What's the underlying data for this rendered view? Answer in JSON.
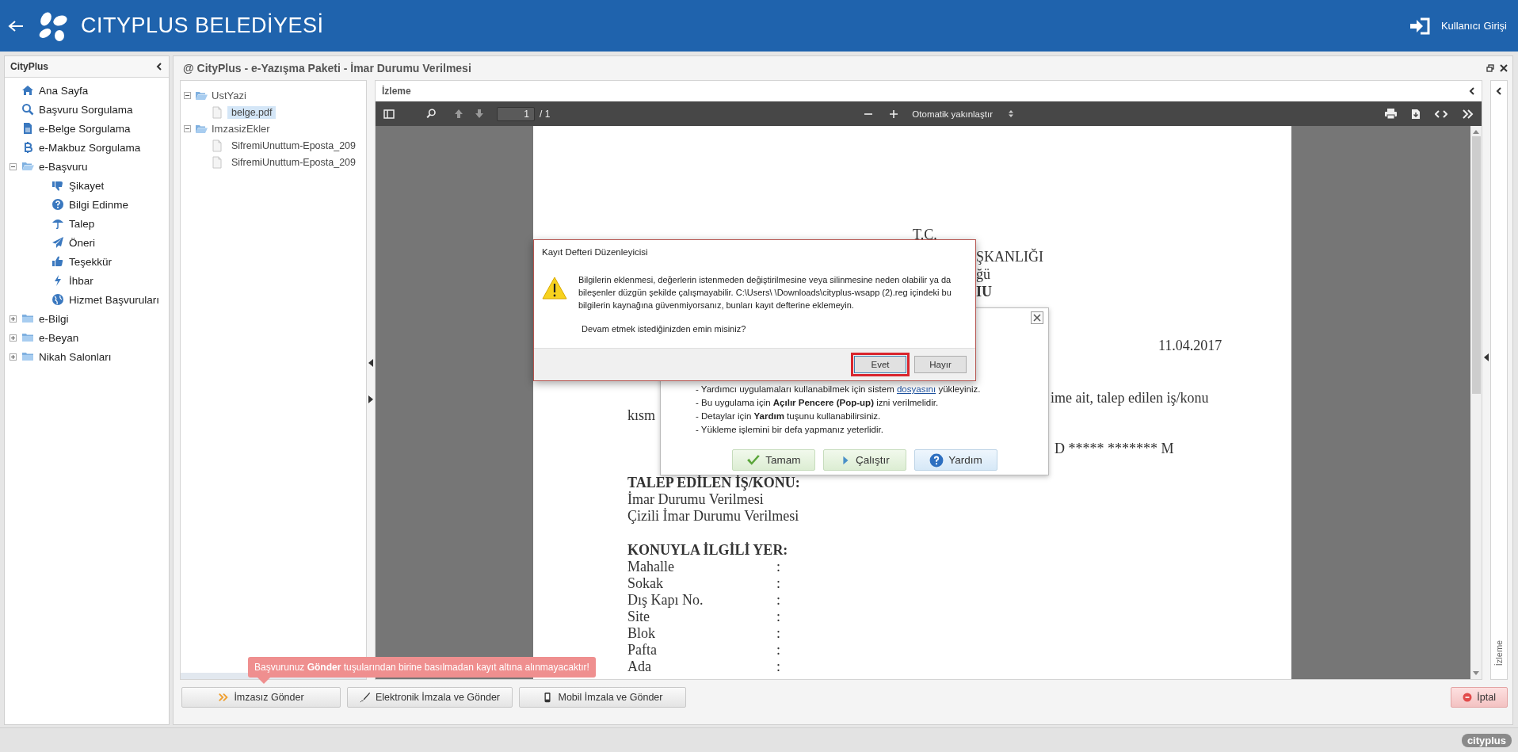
{
  "header": {
    "title": "CITYPLUS BELEDİYESİ",
    "login": "Kullanıcı Girişi"
  },
  "sidebar": {
    "title": "CityPlus",
    "items": [
      {
        "kind": "link",
        "label": "Ana Sayfa"
      },
      {
        "kind": "link",
        "label": "Başvuru Sorgulama"
      },
      {
        "kind": "link",
        "label": "e-Belge Sorgulama"
      },
      {
        "kind": "link",
        "label": "e-Makbuz Sorgulama"
      },
      {
        "kind": "folder",
        "label": "e-Başvuru",
        "expanded": true,
        "children": [
          {
            "kind": "link",
            "label": "Şikayet"
          },
          {
            "kind": "link",
            "label": "Bilgi Edinme"
          },
          {
            "kind": "link",
            "label": "Talep"
          },
          {
            "kind": "link",
            "label": "Öneri"
          },
          {
            "kind": "link",
            "label": "Teşekkür"
          },
          {
            "kind": "link",
            "label": "İhbar"
          },
          {
            "kind": "link",
            "label": "Hizmet Başvuruları"
          }
        ]
      },
      {
        "kind": "folder",
        "label": "e-Bilgi",
        "expanded": false
      },
      {
        "kind": "folder",
        "label": "e-Beyan",
        "expanded": false
      },
      {
        "kind": "folder",
        "label": "Nikah Salonları",
        "expanded": false
      }
    ]
  },
  "panel": {
    "title": "@ CityPlus - e-Yazışma Paketi - İmar Durumu Verilmesi",
    "files": [
      {
        "label": "UstYazi",
        "expanded": true,
        "children": [
          {
            "label": "belge.pdf",
            "selected": true
          }
        ]
      },
      {
        "label": "ImzasizEkler",
        "expanded": true,
        "children": [
          {
            "label": "SifremiUnuttum-Eposta_209",
            "selected": false
          },
          {
            "label": "SifremiUnuttum-Eposta_209",
            "selected": false
          }
        ]
      }
    ],
    "viewer": {
      "title": "İzleme",
      "page_number": "1",
      "page_count": "/ 1",
      "zoom": "Otomatik yakınlaştır",
      "document": {
        "fragments": [
          {
            "text": "T.C.",
            "bold": false
          },
          {
            "text": "ŞKANLIĞI",
            "bold": false
          },
          {
            "text": "ğü",
            "bold": false
          },
          {
            "text": "IU",
            "bold": true
          },
          {
            "text": "11.04.2017",
            "bold": false
          },
          {
            "text": "ime ait, talep edilen iş/konu",
            "bold": false
          },
          {
            "text": "kısm",
            "bold": false
          },
          {
            "text": "D ***** ******* M",
            "bold": false
          }
        ],
        "requested": {
          "heading": "TALEP EDİLEN İŞ/KONU:",
          "lines": [
            "İmar Durumu Verilmesi",
            "Çizili İmar Durumu Verilmesi"
          ]
        },
        "location": {
          "heading": "KONUYLA İLGİLİ YER:",
          "fields": [
            {
              "label": "Mahalle",
              "separator": ":"
            },
            {
              "label": "Sokak",
              "separator": ":"
            },
            {
              "label": "Dış Kapı No.",
              "separator": ":"
            },
            {
              "label": "Site",
              "separator": ":"
            },
            {
              "label": "Blok",
              "separator": ":"
            },
            {
              "label": "Pafta",
              "separator": ":"
            },
            {
              "label": "Ada",
              "separator": ":"
            }
          ]
        }
      }
    },
    "side_tab": "İzleme",
    "actions": [
      {
        "kind": "unsigned",
        "label": "İmzasız Gönder"
      },
      {
        "kind": "esign",
        "label": "Elektronik İmzala ve Gönder"
      },
      {
        "kind": "mobile",
        "label": "Mobil İmzala ve Gönder"
      }
    ],
    "cancel": "İptal",
    "tooltip": "Başvurunuz **Gönder** tuşularından birine basılmadan kayıt altına alınmayacaktır!"
  },
  "help_dialog": {
    "lines": [
      {
        "kind": "link",
        "before": "- Yardımcı uygulamaları kullanabilmek için sistem",
        "link": "dosyasını",
        "after": "yükleyiniz."
      },
      {
        "kind": "text",
        "text": "- Bu uygulama için **Açılır Pencere (Pop-up)** izni verilmelidir."
      },
      {
        "kind": "text",
        "text": "- Detaylar için **Yardım** tuşunu kullanabilirsiniz."
      },
      {
        "kind": "text",
        "text": "- Yükleme işlemini bir defa yapmanız yeterlidir."
      }
    ],
    "buttons": [
      {
        "kind": "ok",
        "label": "Tamam"
      },
      {
        "kind": "run",
        "label": "Çalıştır"
      },
      {
        "kind": "help",
        "label": "Yardım"
      }
    ]
  },
  "registry_dialog": {
    "title": "Kayıt Defteri Düzenleyicisi",
    "message": "Bilgilerin eklenmesi, değerlerin istenmeden değiştirilmesine veya silinmesine neden olabilir ya da bileşenler düzgün şekilde çalışmayabilir. C:\\Users\\ \\Downloads\\cityplus-wsapp (2).reg içindeki bu bilgilerin kaynağına güvenmiyorsanız, bunları kayıt defterine eklemeyin.",
    "question": "Devam etmek istediğinizden emin misiniz?",
    "buttons": [
      {
        "label": "Evet",
        "highlighted": true
      },
      {
        "label": "Hayır",
        "highlighted": false
      }
    ]
  },
  "status_bar": {
    "logo": "cityplus"
  }
}
